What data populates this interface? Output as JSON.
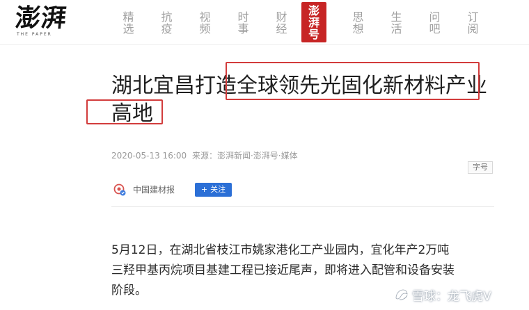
{
  "logo": {
    "main": "澎湃",
    "sub": "THE PAPER"
  },
  "nav": [
    {
      "id": "jingxuan",
      "label": "精选",
      "active": false
    },
    {
      "id": "kangyi",
      "label": "抗疫",
      "active": false
    },
    {
      "id": "shipin",
      "label": "视频",
      "active": false
    },
    {
      "id": "shishi",
      "label": "时事",
      "active": false
    },
    {
      "id": "caijing",
      "label": "财经",
      "active": false
    },
    {
      "id": "pengpaihao",
      "label": "澎湃号",
      "active": true
    },
    {
      "id": "sixiang",
      "label": "思想",
      "active": false
    },
    {
      "id": "shenghuo",
      "label": "生活",
      "active": false
    },
    {
      "id": "wenba",
      "label": "问吧",
      "active": false
    },
    {
      "id": "dingyue",
      "label": "订阅",
      "active": false
    }
  ],
  "breadcrumb": {
    "parent": "澎湃号",
    "separator": ">",
    "current": "中国建材报"
  },
  "article": {
    "title_line1": "湖北宜昌打造全球领先光固化新材料产业",
    "title_line2": "高地",
    "meta": {
      "datetime": "2020-05-13 16:00",
      "source": "来源：澎湃新闻·澎湃号·媒体"
    },
    "font_size_button": "字号",
    "author": {
      "name": "中国建材报",
      "follow_label": "关注",
      "follow_plus": "+"
    },
    "paragraph_lines": [
      "5月12日，在湖北省枝江市姚家港化工产业园内，宜化年产2万吨",
      "三羟甲基丙烷项目基建工程已接近尾声，即将进入配管和设备安装",
      "阶段。"
    ]
  },
  "watermark": {
    "text": "雪球：龙飞虎V",
    "icon": "snowball-logo-icon"
  },
  "colors": {
    "accent_red": "#c72525",
    "link_blue": "#4b7bbd",
    "follow_blue": "#2b6fd6",
    "highlight_red": "#d23c3c"
  }
}
